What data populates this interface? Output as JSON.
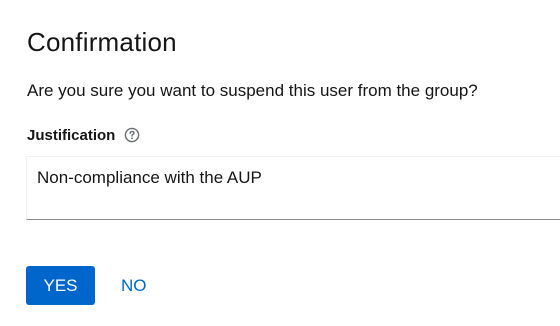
{
  "dialog": {
    "title": "Confirmation",
    "message": "Are you sure you want to suspend this user from the group?"
  },
  "justification": {
    "label": "Justification",
    "help_icon": "question-circle-icon",
    "value": "Non-compliance with the AUP"
  },
  "actions": {
    "confirm_label": "YES",
    "cancel_label": "NO"
  },
  "colors": {
    "primary": "#0066cc",
    "text": "#151515",
    "help_icon": "#6a6e73",
    "input_border_bottom": "#8a8d90"
  }
}
